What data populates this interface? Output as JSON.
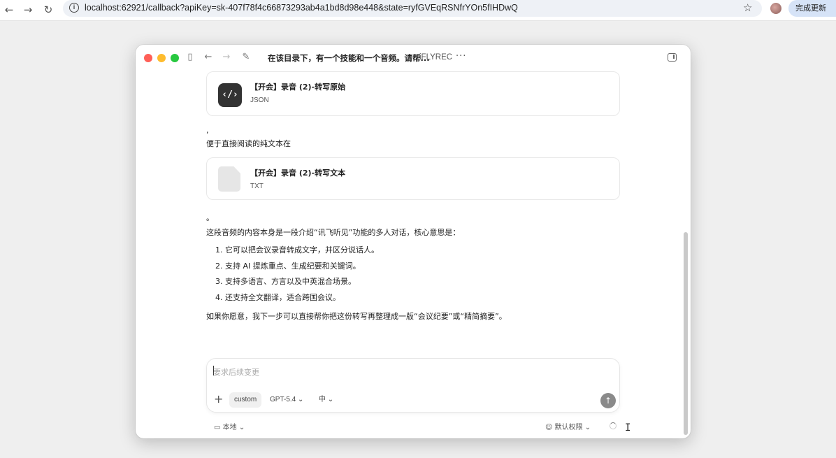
{
  "browser": {
    "back": "←",
    "forward": "→",
    "reload": "↻",
    "url": "localhost:62921/callback?apiKey=sk-407f78f4c66873293ab4a1bd8d98e448&state=ryfGVEqRSNfrYOn5fIHDwQ",
    "site_info": "i",
    "bookmark": "☆",
    "update_button": "完成更新"
  },
  "window": {
    "title": "在该目录下，有一个技能和一个音频。请帮...",
    "app_name": "iFLYREC",
    "more": "···",
    "traffic_lights": {
      "close": "#ff5f57",
      "minimize": "#febc2e",
      "maximize": "#28c840"
    }
  },
  "conversation": {
    "card1": {
      "name": "【开会】录音 (2)-转写原始",
      "type": "JSON",
      "icon": "code-icon",
      "glyph": "‹/›"
    },
    "comma": ",",
    "text_intro": "便于直接阅读的纯文本在",
    "card2": {
      "name": "【开会】录音 (2)-转写文本",
      "type": "TXT",
      "icon": "document-icon"
    },
    "period": "。",
    "summary_intro": "这段音频的内容本身是一段介绍“讯飞听见”功能的多人对话，核心意思是：",
    "points": [
      "1. 它可以把会议录音转成文字，并区分说话人。",
      "2. 支持 AI 提炼重点、生成纪要和关键词。",
      "3. 支持多语言、方言以及中英混合场景。",
      "4. 还支持全文翻译，适合跨国会议。"
    ],
    "closing": "如果你愿意，我下一步可以直接帮你把这份转写再整理成一版“会议纪要”或“精简摘要”。"
  },
  "composer": {
    "placeholder": "要求后续变更",
    "add": "+",
    "mode": "custom",
    "model": "GPT-5.4 ⌄",
    "reasoning": "中 ⌄",
    "send": "↑"
  },
  "footer": {
    "environment": "本地 ⌄",
    "permissions": "默认权限 ⌄"
  }
}
